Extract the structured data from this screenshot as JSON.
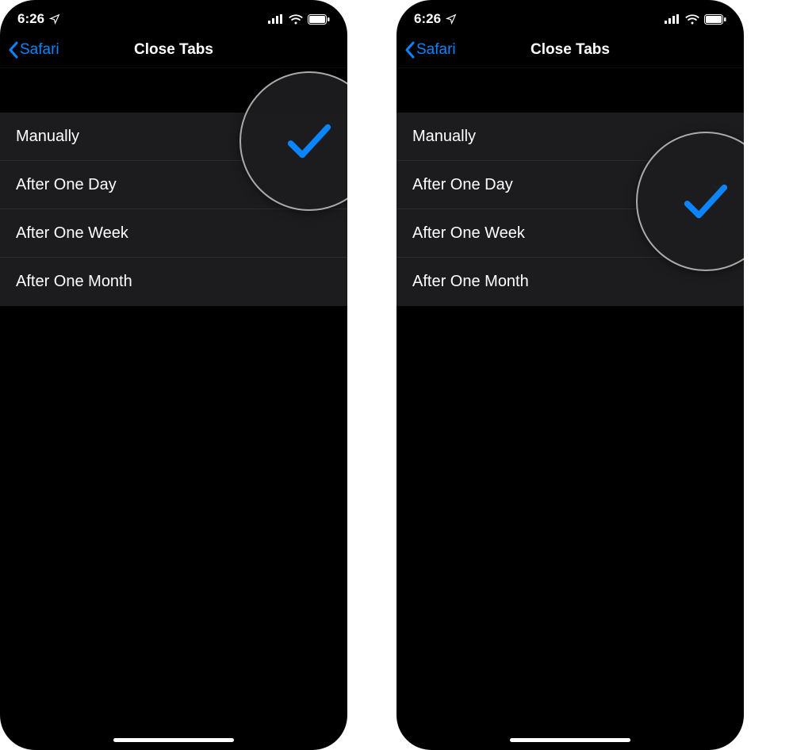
{
  "screens": [
    {
      "status": {
        "time": "6:26",
        "location_icon": "location",
        "signal": "signal",
        "wifi": "wifi",
        "battery": "battery"
      },
      "nav": {
        "back_label": "Safari",
        "title": "Close Tabs"
      },
      "options": [
        {
          "label": "Manually",
          "selected": true
        },
        {
          "label": "After One Day",
          "selected": false
        },
        {
          "label": "After One Week",
          "selected": false
        },
        {
          "label": "After One Month",
          "selected": false
        }
      ],
      "callout_row_index": 0
    },
    {
      "status": {
        "time": "6:26",
        "location_icon": "location",
        "signal": "signal",
        "wifi": "wifi",
        "battery": "battery"
      },
      "nav": {
        "back_label": "Safari",
        "title": "Close Tabs"
      },
      "options": [
        {
          "label": "Manually",
          "selected": false
        },
        {
          "label": "After One Day",
          "selected": true
        },
        {
          "label": "After One Week",
          "selected": false
        },
        {
          "label": "After One Month",
          "selected": false
        }
      ],
      "callout_row_index": 1
    }
  ],
  "colors": {
    "accent": "#0a84ff",
    "bg": "#000",
    "row_bg": "#1c1c1e"
  }
}
